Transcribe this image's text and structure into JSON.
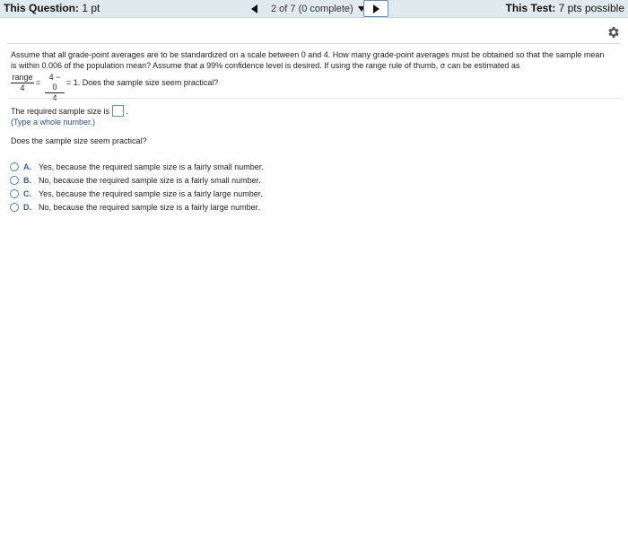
{
  "topbar": {
    "question_label": "This Question:",
    "question_points": " 1 pt",
    "progress_label": "2 of 7 (0 complete)",
    "test_label": "This Test:",
    "test_points": " 7 pts possible"
  },
  "question": {
    "text": "Assume that all grade-point averages are to be standardized on a scale between 0 and 4. How many grade-point averages must be obtained so that the sample mean is within 0.006 of the population mean? Assume that a 99% confidence level is desired. If using the range rule of thumb, σ can be estimated as",
    "frac1_num": "range",
    "frac1_den": "4",
    "equals": "=",
    "frac2_num": "4 − 0",
    "frac2_den": "4",
    "after_formula": "= 1. Does the sample size seem practical?"
  },
  "answer": {
    "label": "The required sample size is",
    "value": "",
    "period": ".",
    "hint": "(Type a whole number.)"
  },
  "practical": {
    "question": "Does the sample size seem practical?",
    "options": [
      {
        "letter": "A.",
        "text": "Yes, because the required sample size is a fairly small number."
      },
      {
        "letter": "B.",
        "text": "No, because the required sample size is a fairly small number."
      },
      {
        "letter": "C.",
        "text": "Yes, because the required sample size is a fairly large number."
      },
      {
        "letter": "D.",
        "text": "No, because the required sample size is a fairly large number."
      }
    ]
  },
  "icons": {
    "prev": "triangle-left-icon",
    "dropdown": "triangle-down-icon",
    "next": "triangle-right-icon",
    "settings": "gear-icon"
  },
  "colors": {
    "topbar_bg": "#dfe9ee",
    "accent_blue": "#4a86c4",
    "hint_text": "#2c4f8f"
  }
}
